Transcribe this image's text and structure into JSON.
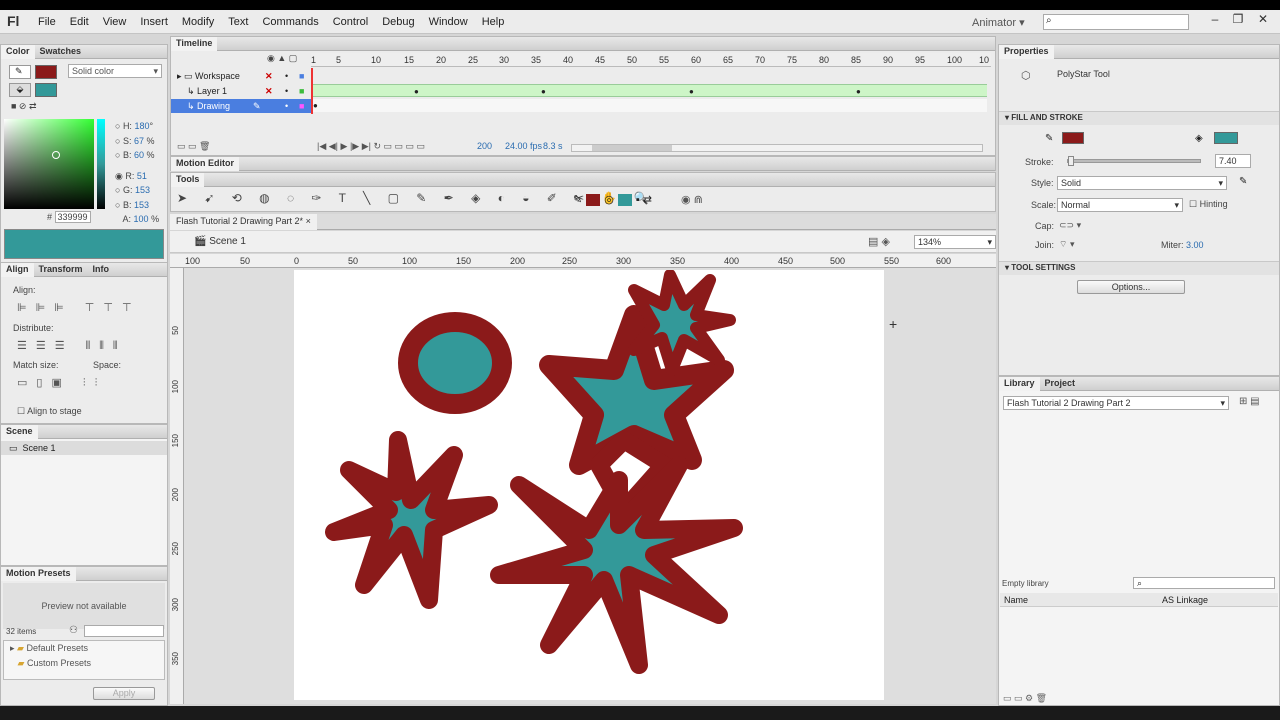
{
  "app": {
    "logo": "Fl",
    "menu": [
      "File",
      "Edit",
      "View",
      "Insert",
      "Modify",
      "Text",
      "Commands",
      "Control",
      "Debug",
      "Window",
      "Help"
    ],
    "workspace": "Animator",
    "workspace_arrow": "▾"
  },
  "color_panel": {
    "tabs": [
      "Color",
      "Swatches"
    ],
    "type": "Solid color",
    "stroke_color": "#8b1a1a",
    "fill_color": "#339999",
    "h_label": "H:",
    "h": "180",
    "h_unit": "°",
    "s_label": "S:",
    "s": "67",
    "s_unit": "%",
    "b_label": "B:",
    "b": "60",
    "b_unit": "%",
    "r_label": "R:",
    "r": "51",
    "g_label": "G:",
    "g": "153",
    "b2_label": "B:",
    "b2": "153",
    "hex_label": "#",
    "hex": "339999",
    "a_label": "A:",
    "a": "100",
    "a_unit": "%"
  },
  "align_panel": {
    "tabs": [
      "Align",
      "Transform",
      "Info"
    ],
    "align": "Align:",
    "distribute": "Distribute:",
    "match": "Match size:",
    "space": "Space:",
    "stage": "Align to stage"
  },
  "scene_panel": {
    "title": "Scene",
    "item": "Scene 1"
  },
  "motion_presets": {
    "title": "Motion Presets",
    "preview": "Preview not available",
    "count": "32 items",
    "folders": [
      "Default Presets",
      "Custom Presets"
    ],
    "apply": "Apply"
  },
  "timeline": {
    "title": "Timeline",
    "frames": [
      "1",
      "5",
      "10",
      "15",
      "20",
      "25",
      "30",
      "35",
      "40",
      "45",
      "50",
      "55",
      "60",
      "65",
      "70",
      "75",
      "80",
      "85",
      "90",
      "95",
      "100",
      "10"
    ],
    "layers": [
      "Workspace",
      "Layer 1",
      "Drawing"
    ],
    "frame": "200",
    "fps": "24.00 fps",
    "time": "8.3 s"
  },
  "motion_editor": {
    "title": "Motion Editor"
  },
  "tools": {
    "title": "Tools"
  },
  "document": {
    "tab": "Flash Tutorial 2 Drawing Part 2*",
    "close": "×",
    "scene": "Scene 1",
    "zoom": "134%",
    "ruler": [
      "100",
      "50",
      "0",
      "50",
      "100",
      "150",
      "200",
      "250",
      "300",
      "350",
      "400",
      "450",
      "500",
      "550",
      "600"
    ],
    "vruler": [
      "50",
      "100",
      "150",
      "200",
      "250",
      "300",
      "350"
    ]
  },
  "properties": {
    "title": "Properties",
    "tool": "PolyStar Tool",
    "fill_stroke": "FILL AND STROKE",
    "stroke_label": "Stroke:",
    "stroke": "7.40",
    "style_label": "Style:",
    "style": "Solid",
    "scale_label": "Scale:",
    "scale": "Normal",
    "hinting": "Hinting",
    "cap_label": "Cap:",
    "join_label": "Join:",
    "miter_label": "Miter:",
    "miter": "3.00",
    "tool_settings": "TOOL SETTINGS",
    "options": "Options..."
  },
  "library": {
    "tabs": [
      "Library",
      "Project"
    ],
    "doc": "Flash Tutorial 2 Drawing Part 2",
    "empty": "Empty library",
    "col_name": "Name",
    "col_linkage": "AS Linkage"
  }
}
